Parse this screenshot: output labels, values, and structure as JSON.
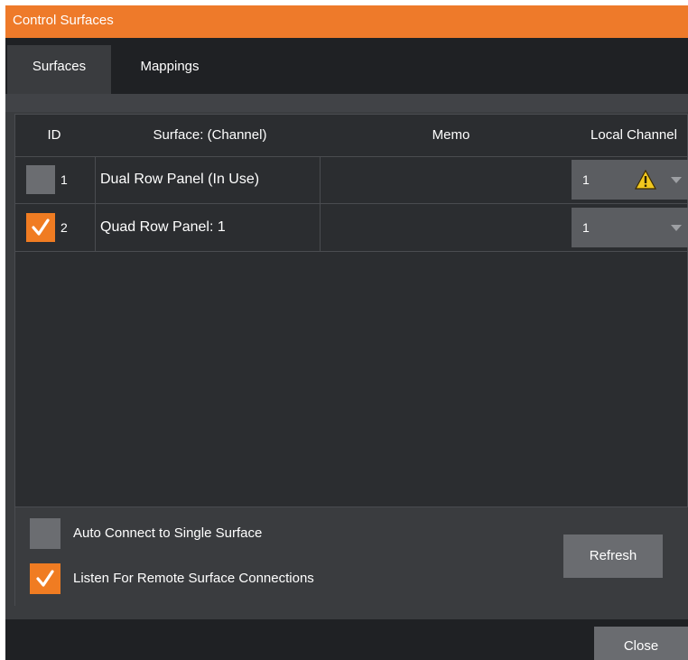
{
  "window": {
    "title": "Control Surfaces"
  },
  "tabs": [
    {
      "label": "Surfaces",
      "active": true
    },
    {
      "label": "Mappings",
      "active": false
    }
  ],
  "table": {
    "headers": {
      "id": "ID",
      "surface": "Surface: (Channel)",
      "memo": "Memo",
      "local_channel": "Local Channel"
    },
    "rows": [
      {
        "checked": false,
        "id": "1",
        "surface": "Dual Row Panel (In Use)",
        "memo": "",
        "local_channel": "1",
        "warning": true
      },
      {
        "checked": true,
        "id": "2",
        "surface": "Quad Row Panel: 1",
        "memo": "",
        "local_channel": "1",
        "warning": false
      }
    ]
  },
  "options": {
    "auto_connect": {
      "label": "Auto Connect to Single Surface",
      "checked": false
    },
    "listen_remote": {
      "label": "Listen For Remote Surface Connections",
      "checked": true
    }
  },
  "buttons": {
    "refresh": "Refresh",
    "close": "Close"
  },
  "colors": {
    "accent": "#ee7a2a",
    "background": "#3a3c3f",
    "grid": "#2b2d30",
    "warning": "#f2c81e"
  }
}
